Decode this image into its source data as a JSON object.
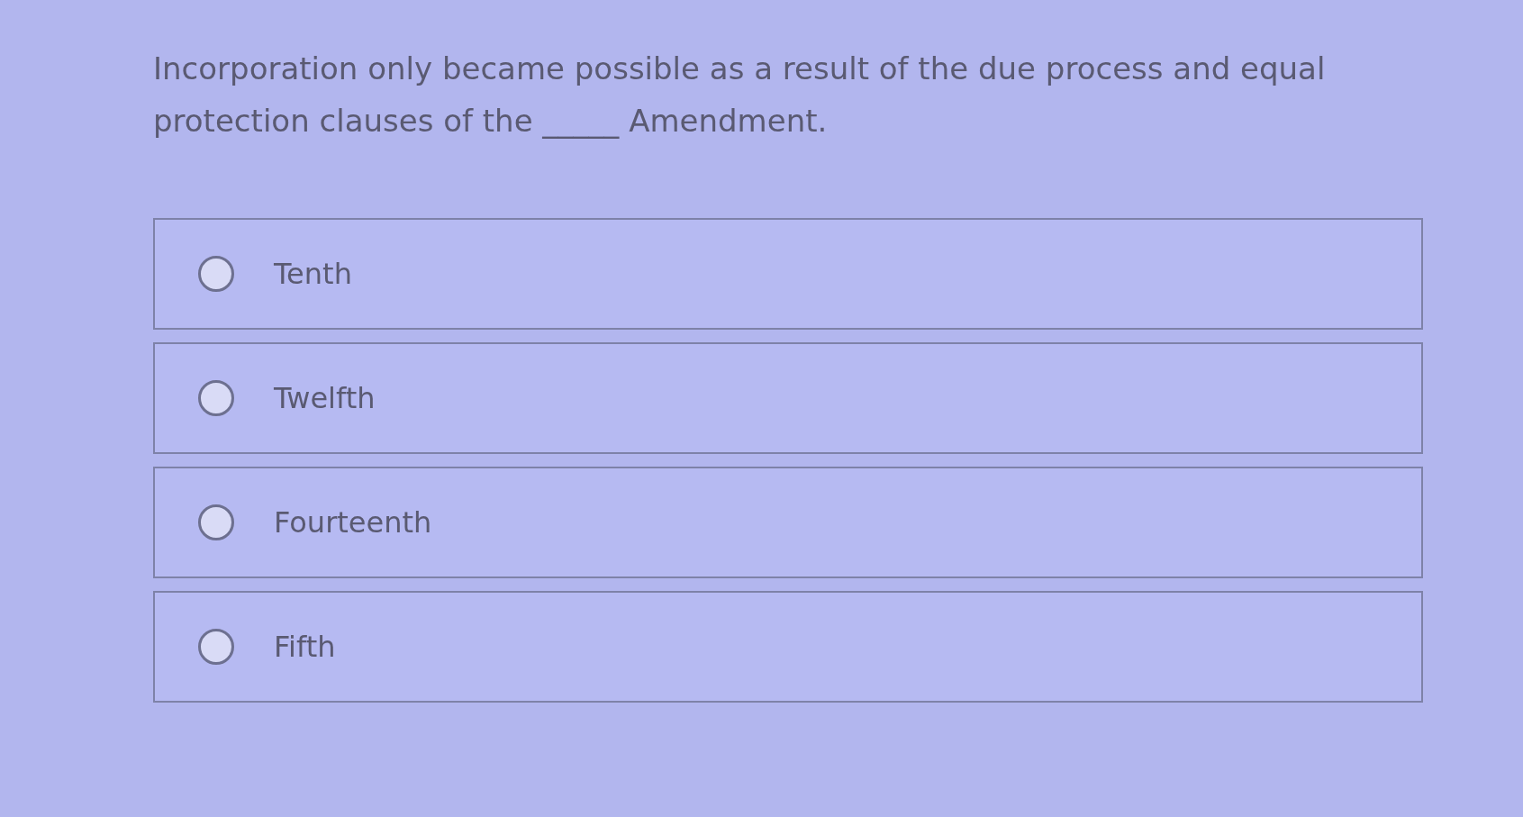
{
  "question": {
    "text": "Incorporation only became possible as a result of the due process and equal protection clauses of the _____ Amendment."
  },
  "options": [
    {
      "label": "Tenth",
      "selected": false
    },
    {
      "label": "Twelfth",
      "selected": false
    },
    {
      "label": "Fourteenth",
      "selected": false
    },
    {
      "label": "Fifth",
      "selected": false
    }
  ]
}
